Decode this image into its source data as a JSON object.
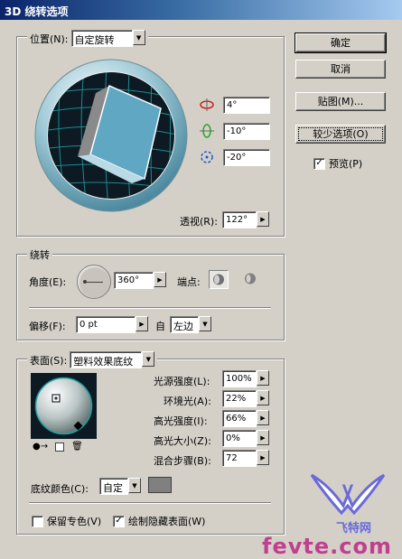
{
  "window": {
    "title": "3D 绕转选项"
  },
  "position": {
    "label": "位置(N):",
    "preset": "自定旋转",
    "x_angle": "4°",
    "y_angle": "-10°",
    "z_angle": "-20°",
    "perspective_label": "透视(R):",
    "perspective": "122°"
  },
  "revolve": {
    "legend": "绕转",
    "angle_label": "角度(E):",
    "angle": "360°",
    "cap_label": "端点:",
    "offset_label": "偏移(F):",
    "offset": "0 pt",
    "from_label": "自",
    "from_value": "左边"
  },
  "surface": {
    "label": "表面(S):",
    "value": "塑料效果底纹",
    "light_intensity_label": "光源强度(L):",
    "light_intensity": "100%",
    "ambient_label": "环境光(A):",
    "ambient": "22%",
    "highlight_intensity_label": "高光强度(I):",
    "highlight_intensity": "66%",
    "highlight_size_label": "高光大小(Z):",
    "highlight_size": "0%",
    "blend_steps_label": "混合步骤(B):",
    "blend_steps": "72",
    "shade_color_label": "底纹颜色(C):",
    "shade_color": "自定",
    "shade_swatch_color": "#808080"
  },
  "options": {
    "preserve_spot_label": "保留专色(V)",
    "preserve_spot_checked": false,
    "draw_hidden_label": "绘制隐藏表面(W)",
    "draw_hidden_checked": true
  },
  "buttons": {
    "ok": "确定",
    "cancel": "取消",
    "map_art": "贴图(M)...",
    "fewer_options": "较少选项(O)",
    "preview_label": "预览(P)",
    "preview_checked": true
  },
  "watermark": {
    "logo_text": "飞特网",
    "url": "fevte.com"
  },
  "icons": {
    "x_axis": "rotate-x-icon",
    "y_axis": "rotate-y-icon",
    "z_axis": "rotate-z-icon"
  },
  "colors": {
    "cube_front": "#5fa7c3",
    "cube_side": "#8a8a8a",
    "track_bg": "#0d1a24",
    "grid": "#1fa0a0",
    "sphere": "#b9c4c4",
    "watermark": "#c04090"
  }
}
